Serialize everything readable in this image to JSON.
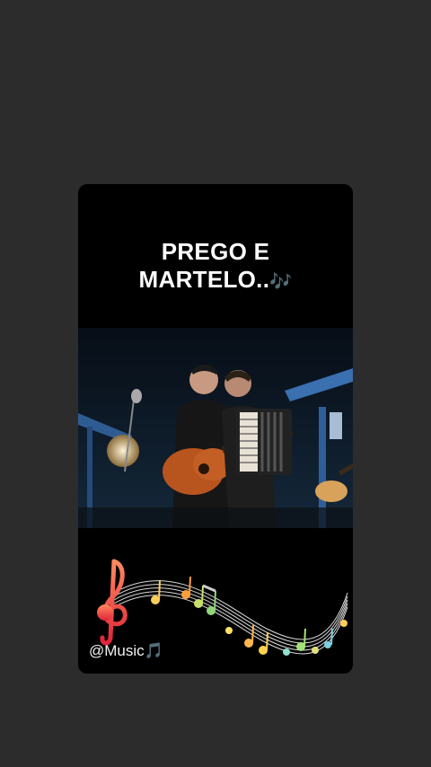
{
  "post": {
    "caption_line1": "PREGO E",
    "caption_line2": "MARTELO..",
    "caption_notes": "🎶",
    "video_description": "",
    "handle": "@Music",
    "handle_note": "🎵"
  },
  "icons": {
    "treble_clef": "treble-clef-icon",
    "music_notes": "music-staff-notes-icon"
  },
  "colors": {
    "background": "#2c2c2c",
    "card": "#000000",
    "text": "#ffffff",
    "notes_accent": "#9cc7c7"
  }
}
